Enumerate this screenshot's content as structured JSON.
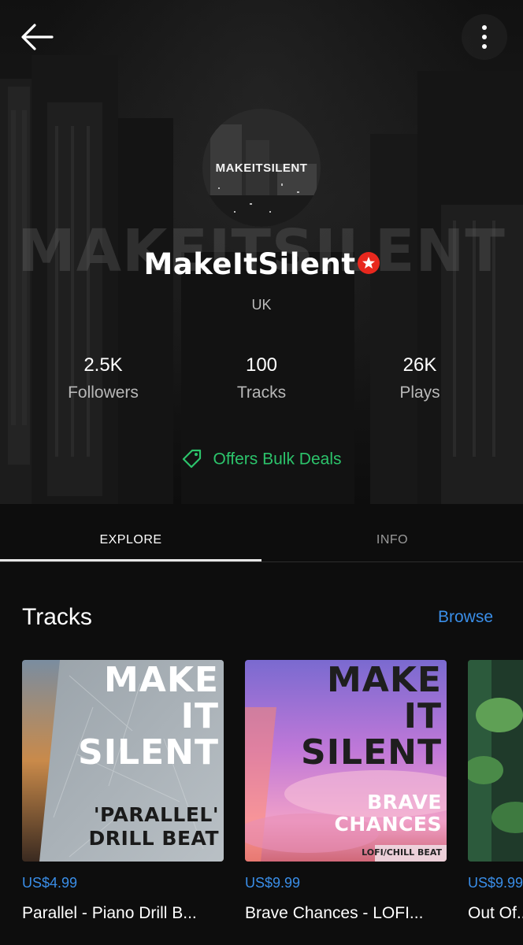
{
  "header": {
    "back_icon": "arrow-left-icon",
    "more_icon": "more-vertical-icon"
  },
  "profile": {
    "watermark": "MAKEITSILENT",
    "avatar_text": "MAKEITSILENT",
    "name": "MakeItSilent",
    "verified_icon": "verified-star-icon",
    "location": "UK"
  },
  "stats": [
    {
      "value": "2.5K",
      "label": "Followers"
    },
    {
      "value": "100",
      "label": "Tracks"
    },
    {
      "value": "26K",
      "label": "Plays"
    }
  ],
  "deals": {
    "icon": "tag-icon",
    "label": "Offers Bulk Deals",
    "color": "#2cc36b"
  },
  "tabs": [
    {
      "label": "EXPLORE",
      "active": true
    },
    {
      "label": "INFO",
      "active": false
    }
  ],
  "tracks_section": {
    "title": "Tracks",
    "browse_label": "Browse",
    "accent": "#3a8ee8"
  },
  "tracks": [
    {
      "price": "US$4.99",
      "title": "Parallel - Piano Drill B...",
      "cover_line1": "MAKE",
      "cover_line2": "IT",
      "cover_line3": "SILENT",
      "cover_sub1": "'PARALLEL'",
      "cover_sub2": "DRILL BEAT"
    },
    {
      "price": "US$9.99",
      "title": "Brave Chances - LOFI...",
      "cover_line1": "MAKE",
      "cover_line2": "IT",
      "cover_line3": "SILENT",
      "cover_sub1": "BRAVE",
      "cover_sub2": "CHANCES",
      "cover_tag": "LOFI/CHILL BEAT"
    },
    {
      "price": "US$9.99",
      "title": "Out Of..."
    }
  ]
}
